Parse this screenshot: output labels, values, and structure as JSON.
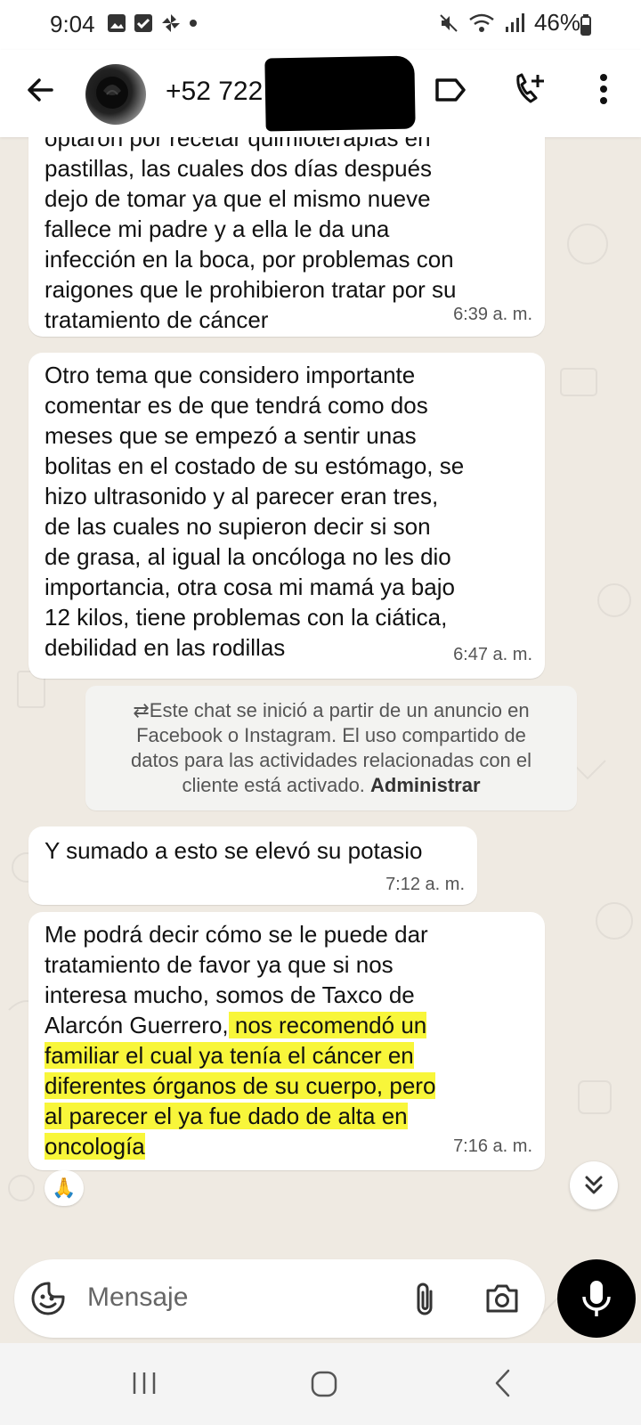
{
  "status_bar": {
    "time": "9:04",
    "battery": "46%"
  },
  "header": {
    "contact": "+52 722 6"
  },
  "messages": [
    {
      "lines": [
        "optaron por recetar quimioterapias en",
        "pastillas, las cuales dos días después",
        "dejo de tomar ya que el mismo nueve",
        "fallece mi padre y a ella le da una",
        "infección en la boca, por problemas con",
        "raigones que le prohibieron tratar por su",
        "tratamiento de cáncer"
      ],
      "time": "6:39 a. m."
    },
    {
      "lines": [
        "Otro tema que considero importante",
        "comentar es de que tendrá como dos",
        "meses que se empezó a sentir unas",
        "bolitas en el costado de su estómago, se",
        "hizo ultrasonido y al parecer eran tres,",
        "de las cuales no supieron decir si son",
        "de grasa, al igual la oncóloga no les dio",
        "importancia, otra cosa mi mamá ya bajo",
        "12 kilos, tiene problemas con la ciática,",
        "debilidad en las rodillas"
      ],
      "time": "6:47 a. m."
    },
    {
      "lines": [
        "Y sumado a esto se elevó su potasio"
      ],
      "time": "7:12 a. m."
    },
    {
      "lines": [
        "Me podrá decir cómo se le puede dar",
        "tratamiento de favor ya que si nos",
        "interesa mucho, somos de Taxco de"
      ],
      "line4_plain": "Alarcón Guerrero,",
      "line4_highlight": " nos recomendó un",
      "highlighted_lines": [
        "familiar el cual ya tenía el cáncer en",
        "diferentes órganos de su cuerpo, pero",
        "al parecer el ya fue dado de alta en",
        "oncología"
      ],
      "time": "7:16 a. m.",
      "reaction": "🙏"
    }
  ],
  "system_notice": {
    "lines": [
      "⇄Este chat se inició a partir de un anuncio en",
      "Facebook o Instagram. El uso compartido de",
      "datos para las actividades relacionadas con el"
    ],
    "line4_text": "cliente está activado. ",
    "action": "Administrar"
  },
  "input": {
    "placeholder": "Mensaje"
  },
  "colors": {
    "highlight": "#f8f63a",
    "chat_bg": "#efeae2",
    "bubble": "#ffffff",
    "mic_button": "#000000"
  },
  "icons": [
    "back-arrow-icon",
    "label-icon",
    "add-call-icon",
    "more-vert-icon",
    "emoji-sticker-icon",
    "attach-clip-icon",
    "camera-icon",
    "mic-icon",
    "chevron-double-down-icon",
    "nav-recent-icon",
    "nav-home-icon",
    "nav-back-icon"
  ]
}
